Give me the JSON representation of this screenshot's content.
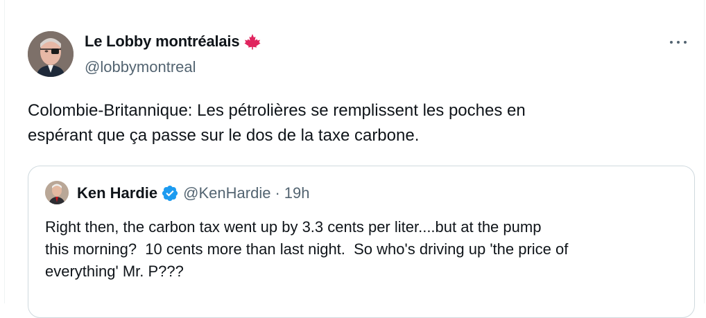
{
  "tweet": {
    "author": {
      "display_name": "Le Lobby montréalais",
      "handle": "@lobbymontreal",
      "flag_icon": "maple-leaf-icon",
      "flag_color": "#e0245e"
    },
    "text": "Colombie-Britannique: Les pétrolières se remplissent les poches en\nespérant que ça passe sur le dos de la taxe carbone.",
    "more_icon": "more-options-icon"
  },
  "quoted_tweet": {
    "author": {
      "display_name": "Ken Hardie",
      "handle": "@KenHardie",
      "verified_icon": "verified-badge-icon",
      "verified_color": "#1d9bf0"
    },
    "separator": "·",
    "time": "19h",
    "text": "Right then, the carbon tax went up by 3.3 cents per liter....but at the pump\nthis morning?  10 cents more than last night.  So who's driving up 'the price of\neverything' Mr. P???"
  }
}
